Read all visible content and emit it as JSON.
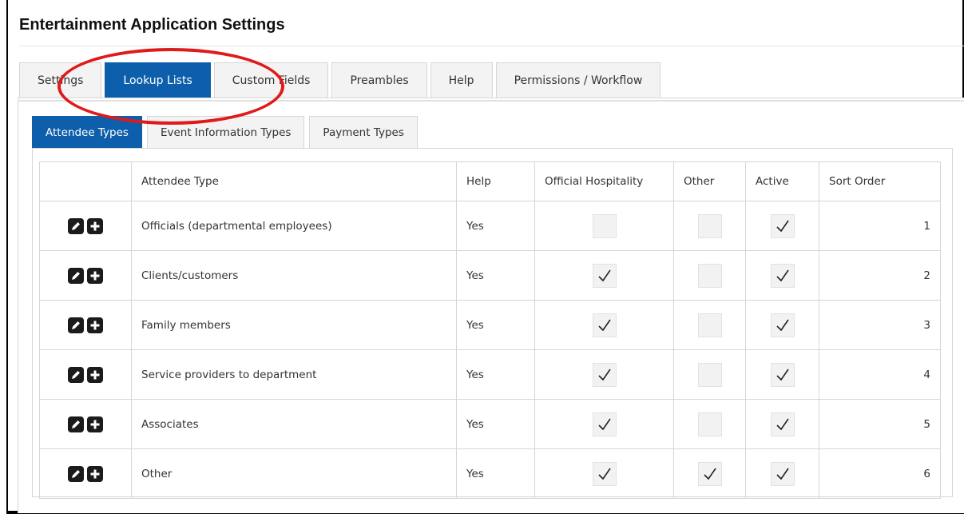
{
  "app": {
    "title": "Entertainment Application Settings"
  },
  "tabs": [
    {
      "label": "Settings",
      "active": false
    },
    {
      "label": "Lookup Lists",
      "active": true
    },
    {
      "label": "Custom Fields",
      "active": false
    },
    {
      "label": "Preambles",
      "active": false
    },
    {
      "label": "Help",
      "active": false
    },
    {
      "label": "Permissions / Workflow",
      "active": false
    }
  ],
  "subtabs": [
    {
      "label": "Attendee Types",
      "active": true
    },
    {
      "label": "Event Information Types",
      "active": false
    },
    {
      "label": "Payment Types",
      "active": false
    }
  ],
  "table": {
    "columns": [
      "",
      "Attendee Type",
      "Help",
      "Official Hospitality",
      "Other",
      "Active",
      "Sort Order"
    ],
    "rows": [
      {
        "type": "Officials (departmental employees)",
        "help": "Yes",
        "official_hospitality": false,
        "other": false,
        "active": true,
        "sort_order": "1"
      },
      {
        "type": "Clients/customers",
        "help": "Yes",
        "official_hospitality": true,
        "other": false,
        "active": true,
        "sort_order": "2"
      },
      {
        "type": "Family members",
        "help": "Yes",
        "official_hospitality": true,
        "other": false,
        "active": true,
        "sort_order": "3"
      },
      {
        "type": "Service providers to department",
        "help": "Yes",
        "official_hospitality": true,
        "other": false,
        "active": true,
        "sort_order": "4"
      },
      {
        "type": "Associates",
        "help": "Yes",
        "official_hospitality": true,
        "other": false,
        "active": true,
        "sort_order": "5"
      },
      {
        "type": "Other",
        "help": "Yes",
        "official_hospitality": true,
        "other": true,
        "active": true,
        "sort_order": "6"
      }
    ]
  },
  "icons": {
    "edit": "pencil-icon",
    "add": "plus-icon"
  },
  "colors": {
    "accent": "#0d5eab",
    "annotation": "#e01a1a"
  }
}
